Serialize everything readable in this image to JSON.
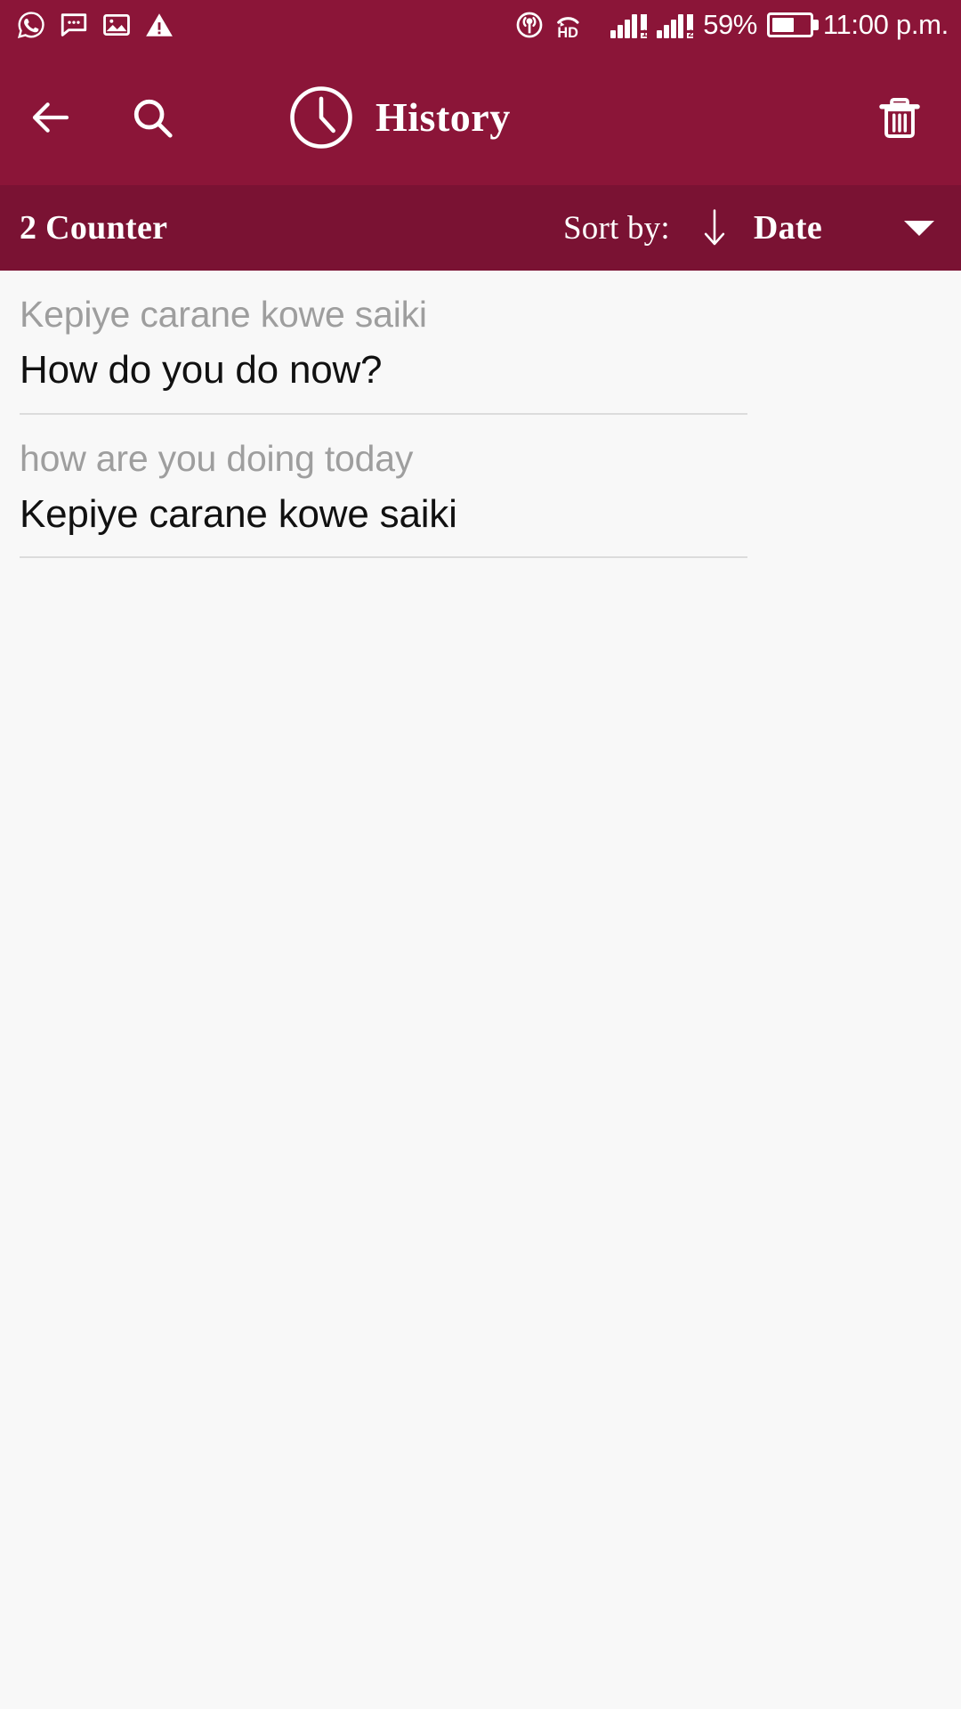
{
  "theme": {
    "primary": "#8B1538",
    "primary_dark": "#7A1233",
    "page_background": "#f8f8f8",
    "source_text_color": "#9e9e9e",
    "target_text_color": "#111111",
    "divider_color": "#dcdcdc",
    "on_primary": "#ffffff"
  },
  "status_bar": {
    "left_icons": [
      {
        "name": "whatsapp-icon",
        "label": "WhatsApp"
      },
      {
        "name": "message-icon",
        "label": "Messages"
      },
      {
        "name": "image-icon",
        "label": "Screenshot"
      },
      {
        "name": "warning-icon",
        "label": "Warning"
      }
    ],
    "right_icons": [
      {
        "name": "hotspot-icon",
        "label": "Hotspot"
      },
      {
        "name": "hd-call-icon",
        "label": "HD"
      }
    ],
    "sim1_label": "1",
    "sim2_label": "2",
    "battery_percent": "59%",
    "battery_level": 60,
    "time": "11:00 p.m."
  },
  "toolbar": {
    "back_label": "Back",
    "search_label": "Search",
    "title": "History",
    "clock_icon_label": "History clock",
    "delete_label": "Clear history"
  },
  "sort_bar": {
    "counter": "2 Counter",
    "sort_by_label": "Sort by:",
    "sort_direction": "descending",
    "sort_direction_glyph": "↓",
    "sort_value": "Date",
    "dropdown_label": "Open sort options"
  },
  "history": {
    "items": [
      {
        "source": "Kepiye carane kowe saiki",
        "target": "How do you do now?"
      },
      {
        "source": "how are you doing today",
        "target": "Kepiye carane kowe saiki"
      }
    ]
  }
}
